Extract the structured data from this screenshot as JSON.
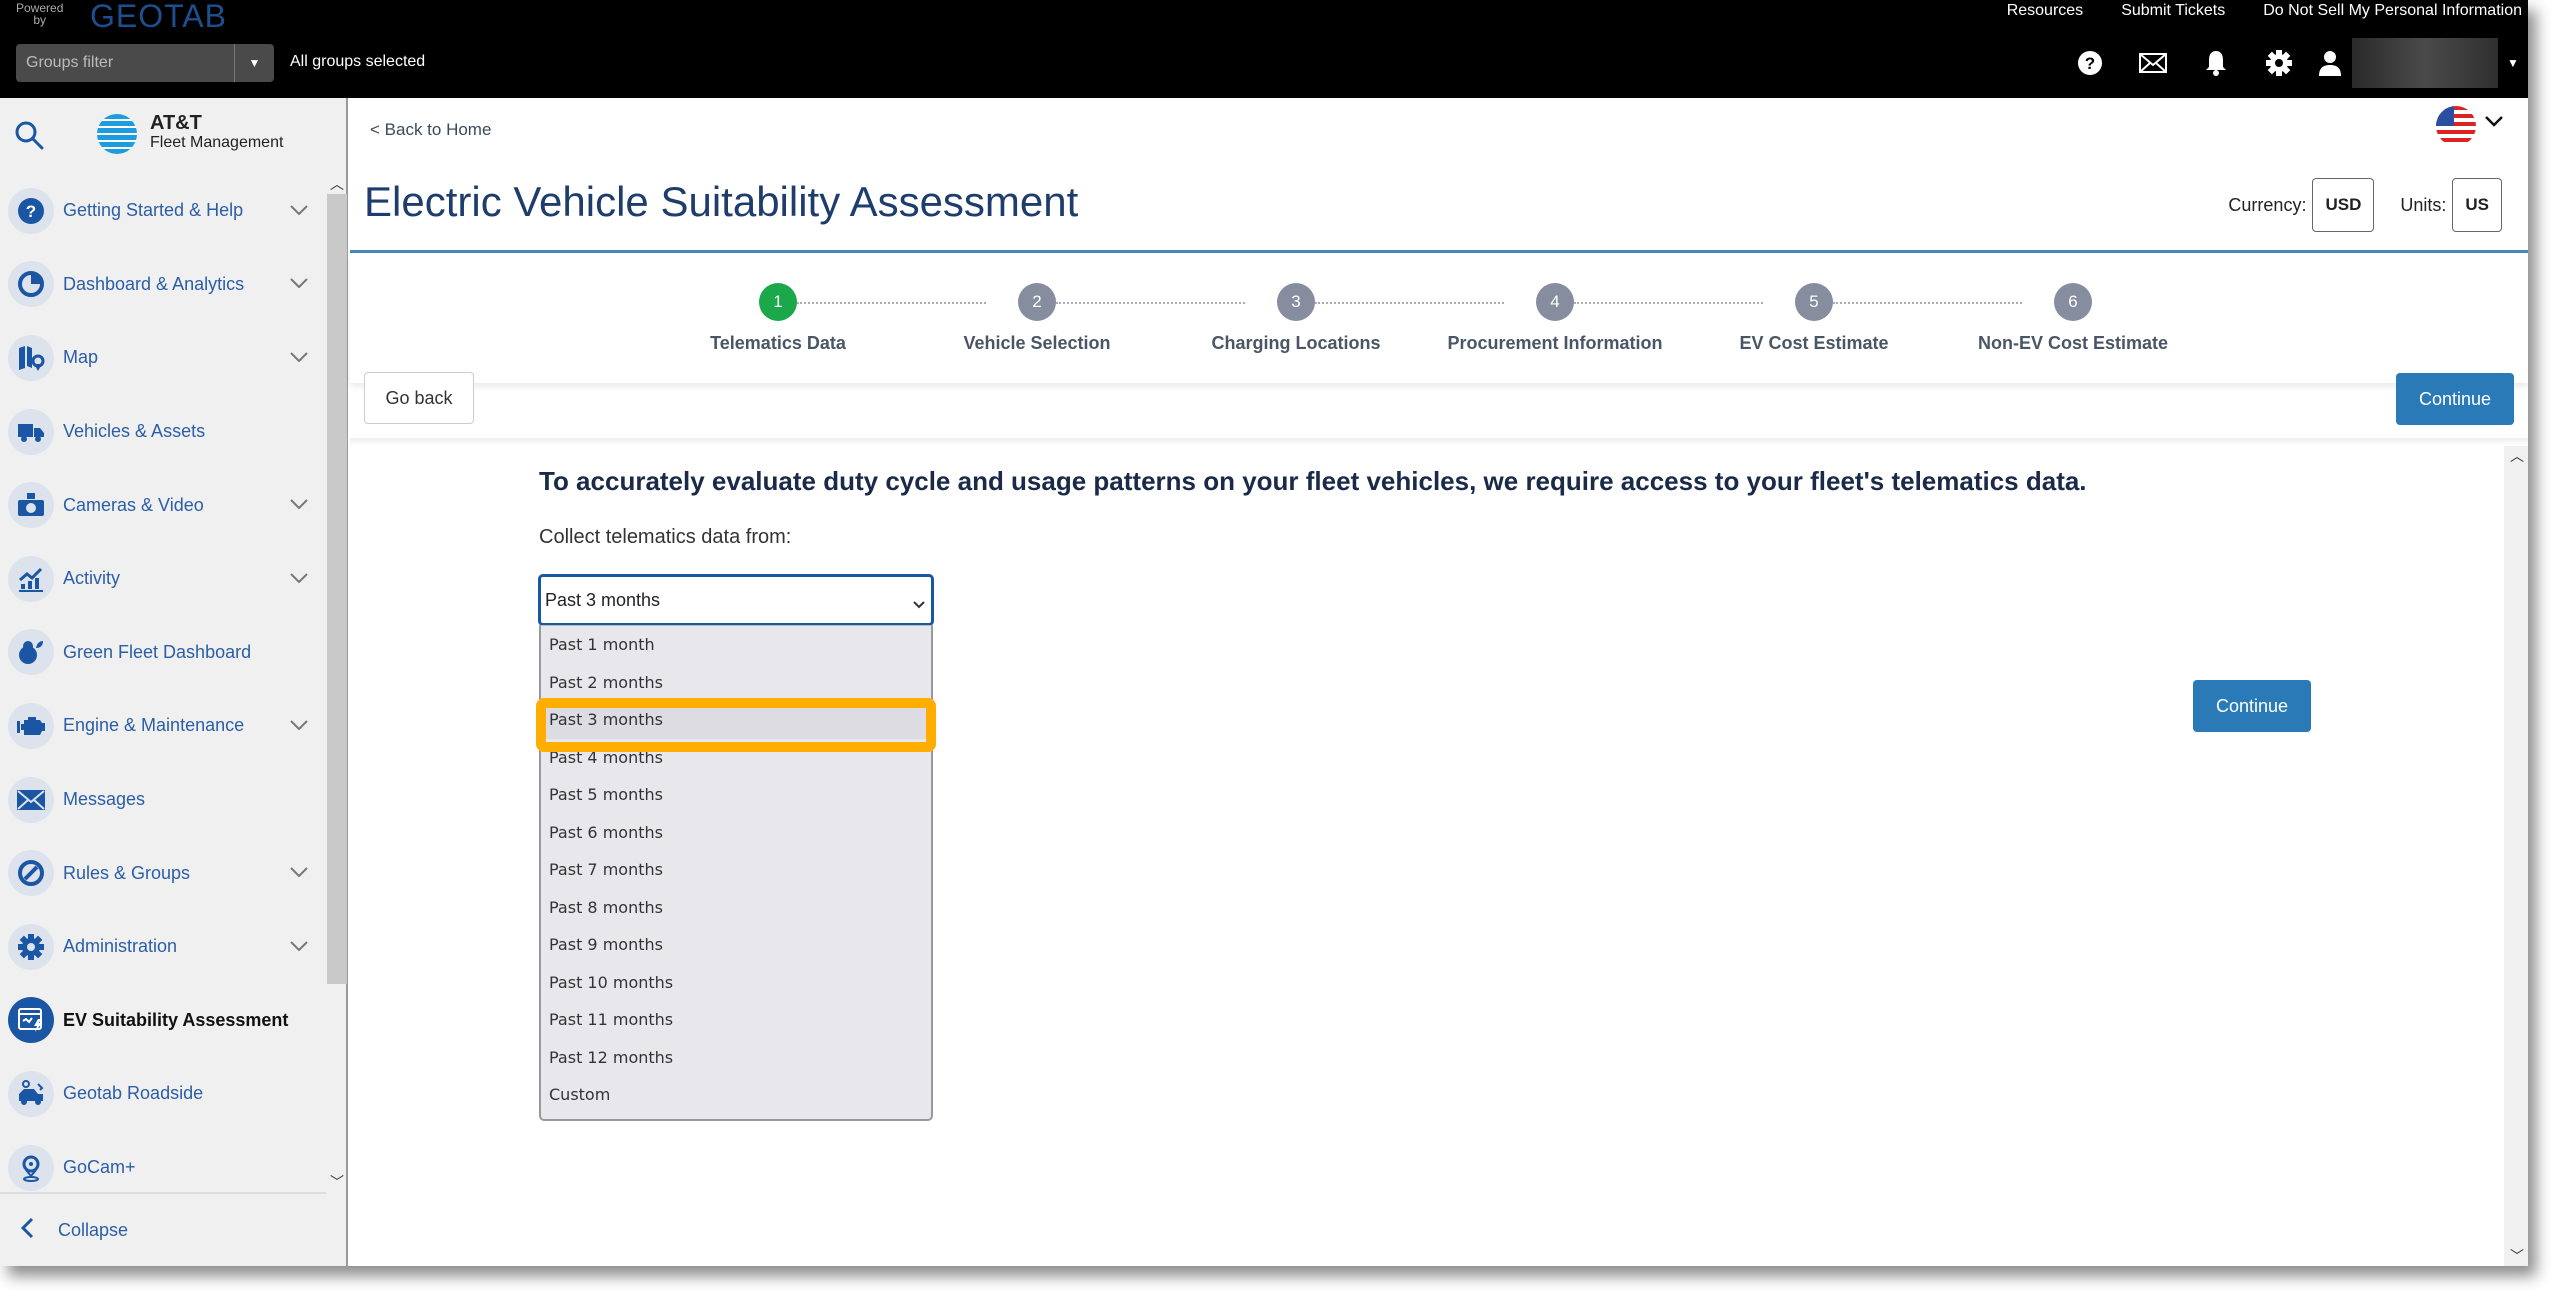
{
  "topbar": {
    "powered_by": "Powered by",
    "brand": "GEOTAB",
    "links": [
      "Resources",
      "Submit Tickets",
      "Do Not Sell My Personal Information"
    ],
    "groups_filter_placeholder": "Groups filter",
    "groups_status": "All groups selected",
    "icons": [
      "help-icon",
      "mail-icon",
      "bell-icon",
      "gear-icon",
      "user-icon"
    ]
  },
  "sidebar": {
    "logo_title": "AT&T",
    "logo_subtitle": "Fleet Management",
    "items": [
      {
        "label": "Getting Started & Help",
        "icon": "help-circle-icon",
        "expandable": true
      },
      {
        "label": "Dashboard & Analytics",
        "icon": "pie-chart-icon",
        "expandable": true
      },
      {
        "label": "Map",
        "icon": "map-icon",
        "expandable": true
      },
      {
        "label": "Vehicles & Assets",
        "icon": "truck-icon",
        "expandable": false
      },
      {
        "label": "Cameras & Video",
        "icon": "camera-icon",
        "expandable": true
      },
      {
        "label": "Activity",
        "icon": "activity-chart-icon",
        "expandable": true
      },
      {
        "label": "Green Fleet Dashboard",
        "icon": "green-fleet-icon",
        "expandable": false
      },
      {
        "label": "Engine & Maintenance",
        "icon": "engine-icon",
        "expandable": true
      },
      {
        "label": "Messages",
        "icon": "envelope-icon",
        "expandable": false
      },
      {
        "label": "Rules & Groups",
        "icon": "rules-icon",
        "expandable": true
      },
      {
        "label": "Administration",
        "icon": "cog-icon",
        "expandable": true
      },
      {
        "label": "EV Suitability Assessment",
        "icon": "ev-assessment-icon",
        "expandable": false,
        "active": true
      },
      {
        "label": "Geotab Roadside",
        "icon": "roadside-icon",
        "expandable": false
      },
      {
        "label": "GoCam+",
        "icon": "gocam-icon",
        "expandable": false
      }
    ],
    "collapse_label": "Collapse"
  },
  "header": {
    "back_link": "< Back to Home",
    "title": "Electric Vehicle Suitability Assessment",
    "currency_label": "Currency:",
    "currency_value": "USD",
    "units_label": "Units:",
    "units_value": "US"
  },
  "stepper": {
    "current_step": 1,
    "steps": [
      {
        "number": "1",
        "label": "Telematics Data"
      },
      {
        "number": "2",
        "label": "Vehicle Selection"
      },
      {
        "number": "3",
        "label": "Charging Locations"
      },
      {
        "number": "4",
        "label": "Procurement Information"
      },
      {
        "number": "5",
        "label": "EV Cost Estimate"
      },
      {
        "number": "6",
        "label": "Non-EV Cost Estimate"
      }
    ],
    "go_back_label": "Go back",
    "continue_label": "Continue"
  },
  "content": {
    "intro": "To accurately evaluate duty cycle and usage patterns on your fleet vehicles, we require access to your fleet's telematics data.",
    "collect_label": "Collect telematics data from:",
    "selected_value": "Past 3 months",
    "options": [
      "Past 1 month",
      "Past 2 months",
      "Past 3 months",
      "Past 4 months",
      "Past 5 months",
      "Past 6 months",
      "Past 7 months",
      "Past 8 months",
      "Past 9 months",
      "Past 10 months",
      "Past 11 months",
      "Past 12 months",
      "Custom"
    ],
    "continue_label": "Continue"
  },
  "colors": {
    "accent_blue": "#2a7ab8",
    "current_step_green": "#1aa84a",
    "pending_step_gray": "#868d9e",
    "highlight_orange": "#ffae00",
    "sidebar_text": "#2b5ea7"
  }
}
